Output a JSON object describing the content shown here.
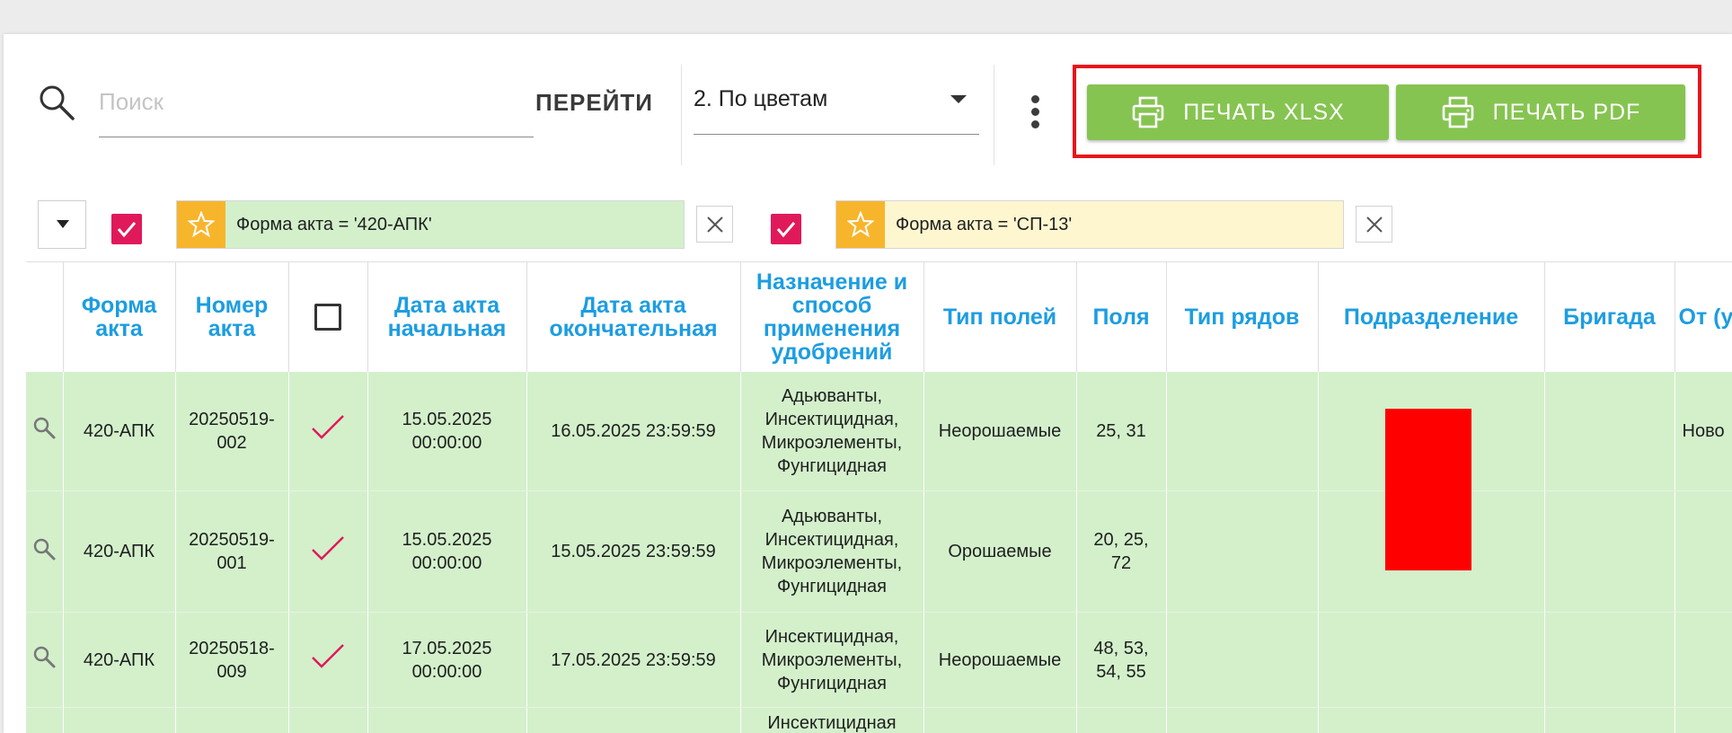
{
  "toolbar": {
    "search_placeholder": "Поиск",
    "search_value": "",
    "goto_label": "ПЕРЕЙТИ",
    "view_select_value": "2. По цветам",
    "print_xlsx_label": "ПЕЧАТЬ XLSX",
    "print_pdf_label": "ПЕЧАТЬ PDF",
    "print_button_color": "#86c451",
    "highlight_color": "#e8131b"
  },
  "filters": [
    {
      "checked": true,
      "text": "Форма акта = '420-АПК'",
      "background": "#d3f0cb"
    },
    {
      "checked": true,
      "text": "Форма акта = 'СП-13'",
      "background": "#fdf6cf"
    }
  ],
  "table": {
    "headers": [
      "",
      "Форма акта",
      "Номер акта",
      "",
      "Дата акта начальная",
      "Дата акта окончательная",
      "Назначение и способ применения удобрений",
      "Тип полей",
      "Поля",
      "Тип рядов",
      "Подразделение",
      "Бригада",
      "От (у"
    ],
    "header_color": "#1d9de1",
    "row_color": "#d3f0cb",
    "rows": [
      {
        "form": "420-АПК",
        "number_l1": "20250519-",
        "number_l2": "002",
        "checked": true,
        "date_start_l1": "15.05.2025",
        "date_start_l2": "00:00:00",
        "date_end": "16.05.2025 23:59:59",
        "purpose": [
          "Адьюванты,",
          "Инсектицидная,",
          "Микроэлементы,",
          "Фунгицидная"
        ],
        "field_type": "Неорошаемые",
        "fields_l1": "25, 31",
        "fields_l2": "",
        "row_type": "",
        "division": "",
        "brigade": "",
        "extra": "Ново"
      },
      {
        "form": "420-АПК",
        "number_l1": "20250519-",
        "number_l2": "001",
        "checked": true,
        "date_start_l1": "15.05.2025",
        "date_start_l2": "00:00:00",
        "date_end": "15.05.2025 23:59:59",
        "purpose": [
          "Адьюванты,",
          "Инсектицидная,",
          "Микроэлементы,",
          "Фунгицидная"
        ],
        "field_type": "Орошаемые",
        "fields_l1": "20, 25,",
        "fields_l2": "72",
        "row_type": "",
        "division": "",
        "brigade": "",
        "extra": ""
      },
      {
        "form": "420-АПК",
        "number_l1": "20250518-",
        "number_l2": "009",
        "checked": true,
        "date_start_l1": "17.05.2025",
        "date_start_l2": "00:00:00",
        "date_end": "17.05.2025 23:59:59",
        "purpose": [
          "Инсектицидная,",
          "Микроэлементы,",
          "Фунгицидная"
        ],
        "field_type": "Неорошаемые",
        "fields_l1": "48, 53,",
        "fields_l2": "54, 55",
        "row_type": "",
        "division": "",
        "brigade": "",
        "extra": ""
      },
      {
        "form": "",
        "number_l1": "",
        "number_l2": "",
        "checked": false,
        "date_start_l1": "",
        "date_start_l2": "",
        "date_end": "",
        "purpose": [
          "Инсектицидная"
        ],
        "field_type": "",
        "fields_l1": "",
        "fields_l2": "",
        "row_type": "",
        "division": "",
        "brigade": "",
        "extra": ""
      }
    ],
    "division_color": "#ff0000"
  }
}
